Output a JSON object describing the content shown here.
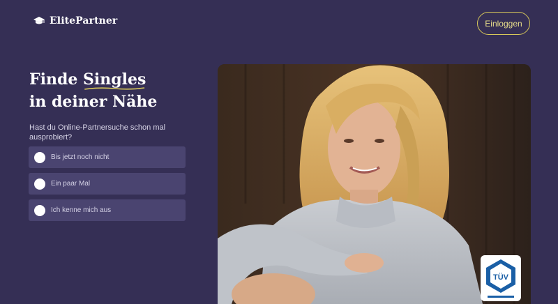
{
  "header": {
    "brand": "ElitePartner",
    "login_label": "Einloggen"
  },
  "hero": {
    "headline_line1_prefix": "Finde ",
    "headline_line1_highlight": "Singles",
    "headline_line2": "in deiner Nähe",
    "question": "Hast du Online-Partnersuche schon mal ausprobiert?",
    "options": [
      {
        "label": "Bis jetzt noch nicht"
      },
      {
        "label": "Ein paar Mal"
      },
      {
        "label": "Ich kenne mich aus"
      }
    ]
  },
  "badge": {
    "brand": "TÜV"
  },
  "colors": {
    "background": "#352f55",
    "option_bg": "#4a4470",
    "accent_gold": "#d8c85a"
  },
  "icons": {
    "logo": "graduation-cap-icon",
    "radio": "radio-button-icon"
  }
}
